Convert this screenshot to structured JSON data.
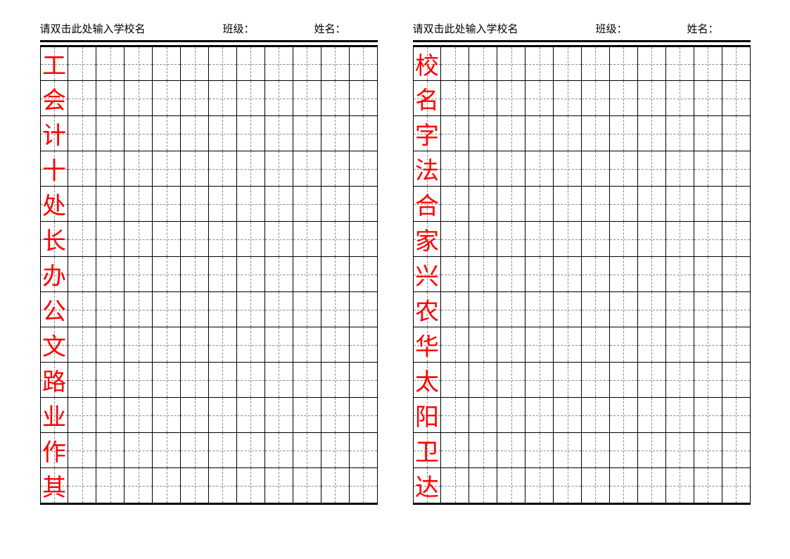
{
  "header": {
    "school_placeholder": "请双击此处输入学校名",
    "class_label": "班级：",
    "name_label": "姓名："
  },
  "grid": {
    "rows": 13,
    "cols": 12
  },
  "sheets": [
    {
      "chars": [
        "工",
        "会",
        "计",
        "十",
        "处",
        "长",
        "办",
        "公",
        "文",
        "路",
        "业",
        "作",
        "其"
      ]
    },
    {
      "chars": [
        "校",
        "名",
        "字",
        "法",
        "合",
        "家",
        "兴",
        "农",
        "华",
        "太",
        "阳",
        "卫",
        "达"
      ]
    }
  ]
}
